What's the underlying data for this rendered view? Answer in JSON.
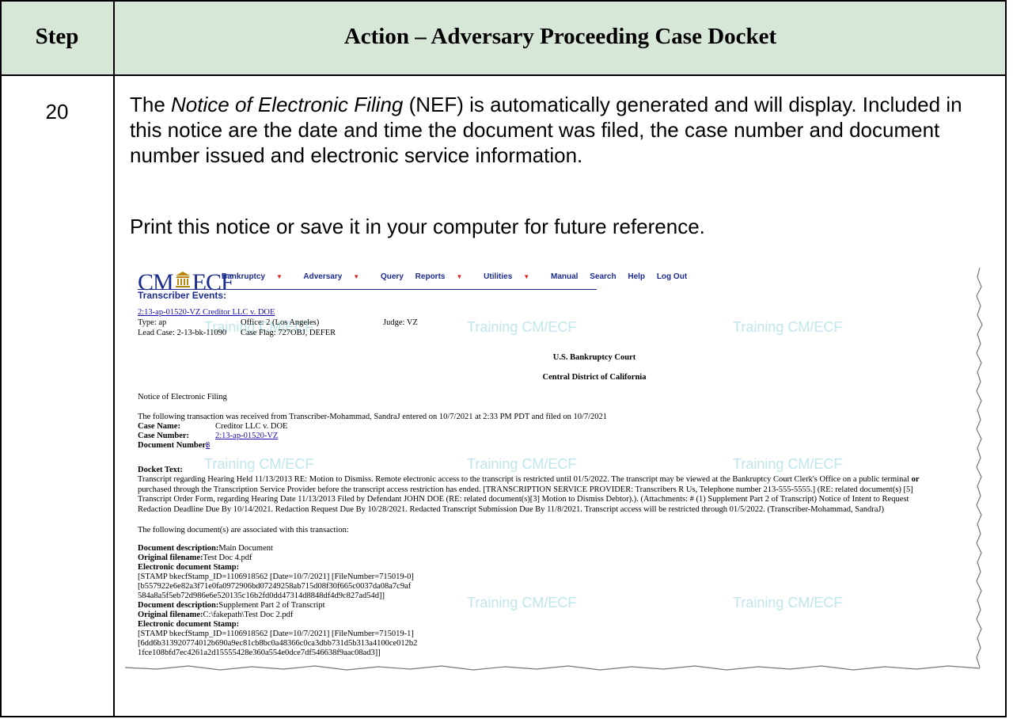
{
  "table": {
    "header_step": "Step",
    "header_action": "Action – Adversary Proceeding Case Docket",
    "step_number": "20",
    "para1_pre": "The ",
    "para1_italic": "Notice of Electronic Filing",
    "para1_rest": " (NEF) is automatically generated and will display. Included in this notice are the date and time the document was filed, the case number and document number issued and electronic service information.",
    "para2": "Print this notice or save it in your computer for future reference."
  },
  "screenshot": {
    "logo": {
      "left": "CM",
      "right": "ECF"
    },
    "menu": [
      {
        "label": "Bankruptcy",
        "dropdown": true
      },
      {
        "label": "Adversary",
        "dropdown": true
      },
      {
        "label": "Query",
        "dropdown": false
      },
      {
        "label": "Reports",
        "dropdown": true
      },
      {
        "label": "Utilities",
        "dropdown": true
      },
      {
        "label": "Manual",
        "dropdown": false
      },
      {
        "label": "Search",
        "dropdown": false
      },
      {
        "label": "Help",
        "dropdown": false
      },
      {
        "label": "Log Out",
        "dropdown": false
      }
    ],
    "page_title": "Transcriber Events:",
    "case_link": "2:13-ap-01520-VZ Creditor LLC v. DOE",
    "type": "Type: ap",
    "office": "Office: 2 (Los Angeles)",
    "judge": "Judge: VZ",
    "lead_case": "Lead Case: 2-13-bk-11090",
    "case_flag": "Case Flag: 727OBJ, DEFER",
    "watermark": "Training CM/ECF",
    "court": "U.S. Bankruptcy Court",
    "district": "Central District of California",
    "nef_title": "Notice of Electronic Filing",
    "transaction": "The following transaction was received from Transcriber-Mohammad, SandraJ entered on 10/7/2021 at 2:33 PM PDT and filed on 10/7/2021",
    "case_name_label": "Case Name:",
    "case_name_value": "Creditor LLC v. DOE",
    "case_number_label": "Case Number:",
    "case_number_value": "2:13-ap-01520-VZ",
    "document_number_label": "Document Number:",
    "document_number_value": "8",
    "docket_text_label": "Docket Text:",
    "docket_line1": "Transcript regarding Hearing Held 11/13/2013 RE: Motion to Dismiss. Remote electronic access to the transcript is restricted until 01/5/2022. The transcript may be viewed at the Bankruptcy Court Clerk's Office on a public terminal",
    "docket_or": "or",
    "docket_line2": "purchased through the Transcription Service Provider before the transcript access restriction has ended. [TRANSCRIPTION SERVICE PROVIDER: Transcribers R Us, Telephone number 213-555-5555.] (RE: related document(s) [5]",
    "docket_line3": "Transcript Order Form, regarding Hearing Date 11/13/2013 Filed by Defendant JOHN DOE (RE: related document(s)[3] Motion to Dismiss Debtor).). (Attachments: # (1) Supplement Part 2 of Transcript) Notice of Intent to Request",
    "docket_line4": "Redaction Deadline Due By 10/14/2021. Redaction Request Due By 10/28/2021. Redacted Transcript Submission Due By 11/8/2021. Transcript access will be restricted through 01/5/2022. (Transcriber-Mohammad, SandraJ)",
    "assoc": "The following document(s) are associated with this transaction:",
    "doc1_desc_label": "Document description:",
    "doc1_desc": "Main Document",
    "doc1_file_label": "Original filename:",
    "doc1_file": "Test Doc 4.pdf",
    "doc1_stamp_label": "Electronic document Stamp:",
    "doc1_stamp1": "[STAMP bkecfStamp_ID=1106918562 [Date=10/7/2021] [FileNumber=715019-0]",
    "doc1_stamp2": "[b557922e6e82a3f71e0fa0972906bd07249258ab715d08f30f665c0037da08a7c9af",
    "doc1_stamp3": "584a8a5f5eb72d986e6e520135c16b2fd0dd47314d8848df4d9c827ad54d]]",
    "doc2_desc_label": "Document description:",
    "doc2_desc": "Supplement Part 2 of Transcript",
    "doc2_file_label": "Original filename:",
    "doc2_file": "C:\\fakepath\\Test Doc 2.pdf",
    "doc2_stamp_label": "Electronic document Stamp:",
    "doc2_stamp1": "[STAMP bkecfStamp_ID=1106918562 [Date=10/7/2021] [FileNumber=715019-1]",
    "doc2_stamp2": "[6dd6b313920774012b690a9ec81cb8bc0a48366c0ca3dbb731d5b313a4100ce012b2",
    "doc2_stamp3": "1fce108bfd7ec4261a2d15555428e360a554e0dce7df546638f9aac08ad3]]"
  },
  "colors": {
    "header_bg": "#d7e7d7",
    "ecf_blue": "#1b2b8f",
    "link_blue": "#1a0dab",
    "watermark": "#bfe6ea"
  }
}
